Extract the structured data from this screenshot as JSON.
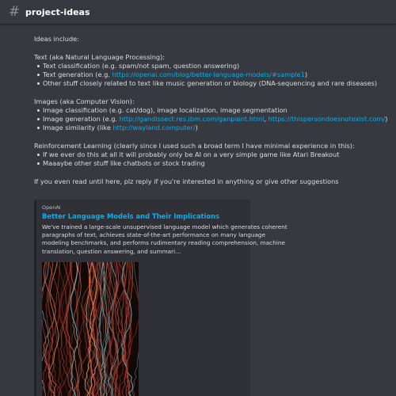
{
  "header": {
    "icon": "hash-icon",
    "channel_name": "project-ideas"
  },
  "message": {
    "intro": "Ideas include:",
    "sections": [
      {
        "heading": "Text (aka Natural Language Processing):",
        "items": [
          {
            "text": "Text classification (e.g. spam/not spam, question answering)"
          },
          {
            "text": "Text generation (e.g. ",
            "link": "https://openai.com/blog/better-language-models/#sample1",
            "suffix": ")"
          },
          {
            "text": "Other stuff closely related to text like music generation or biology (DNA-sequencing and rare diseases)"
          }
        ]
      },
      {
        "heading": "Images (aka Computer Vision):",
        "items": [
          {
            "text": "Image classification (e.g. cat/dog), image localization, image segmentation"
          },
          {
            "text": "Image generation (e.g. ",
            "link": "http://gandissect.res.ibm.com/ganpaint.html",
            "mid": ", ",
            "link2": "https://thispersondoesnotexist.com/",
            "suffix": ")"
          },
          {
            "text": "Image similarity (like ",
            "link": "http://wayland.computer/",
            "suffix": ")"
          }
        ]
      },
      {
        "heading": "Reinforcement Learning (clearly since I used such a broad term I have minimal experience in this):",
        "items": [
          {
            "text": "If we ever do this at all it will probably only be AI on a very simple game like Atari Breakout"
          },
          {
            "text": "Maaaybe other stuff like chatbots or stock trading"
          }
        ]
      }
    ],
    "closing": "If you even read until here, plz reply if you're interested in anything or give other suggestions"
  },
  "embed": {
    "provider": "OpenAI",
    "title": "Better Language Models and Their Implications",
    "description_lines": [
      "We've trained a large-scale unsupervised language model which generates coherent",
      "paragraphs of text, achieves state-of-the-art performance on many language",
      "modeling benchmarks, and performs rudimentary reading comprehension, machine",
      "translation, question answering, and summari..."
    ],
    "image_icon": "abstract-lines-image"
  },
  "colors": {
    "background": "#36393f",
    "embed_background": "#2f3136",
    "link": "#00b0f4",
    "text": "#dcddde"
  }
}
